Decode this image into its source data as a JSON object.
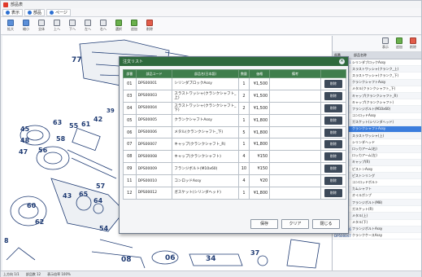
{
  "window": {
    "title": "部品表"
  },
  "menubar": {
    "tabs": [
      {
        "label": "表示"
      },
      {
        "label": "部品"
      },
      {
        "label": "ページ"
      }
    ]
  },
  "toolbar": {
    "buttons": [
      {
        "label": "拡大",
        "icon": "zoom-in-icon"
      },
      {
        "label": "縮小",
        "icon": "zoom-out-icon"
      },
      {
        "label": "全体",
        "icon": "fit-icon"
      },
      {
        "label": "上へ",
        "icon": "up-icon"
      },
      {
        "label": "下へ",
        "icon": "down-icon"
      },
      {
        "label": "左へ",
        "icon": "left-icon"
      },
      {
        "label": "右へ",
        "icon": "right-icon"
      },
      {
        "label": "選択",
        "icon": "select-icon"
      },
      {
        "label": "追加",
        "icon": "add-icon"
      },
      {
        "label": "削除",
        "icon": "delete-icon"
      }
    ]
  },
  "drawing": {
    "part_numbers": [
      "77",
      "39",
      "45",
      "48",
      "47",
      "56",
      "58",
      "55",
      "63",
      "61",
      "42",
      "57",
      "65",
      "43",
      "64",
      "60",
      "62",
      "54",
      "08",
      "06",
      "34",
      "37",
      "8"
    ]
  },
  "right_panel": {
    "toolbar": [
      {
        "label": "表示",
        "icon": "view-icon"
      },
      {
        "label": "追加",
        "icon": "add-icon"
      },
      {
        "label": "削除",
        "icon": "delete-icon"
      }
    ],
    "header": {
      "col1": "部番",
      "col2": "部品名称"
    },
    "rows": [
      {
        "code": "DP500001",
        "name": "シリンダブロックAssy"
      },
      {
        "code": "",
        "name": "スラストワッシャ(クランク_上)"
      },
      {
        "code": "",
        "name": "スラストワッシャ(クランク_下)"
      },
      {
        "code": "",
        "name": "クランクシャフトAssy"
      },
      {
        "code": "",
        "name": "メタル(クランクシャフト_下)"
      },
      {
        "code": "",
        "name": "キャップ(クランクシャフト_R)"
      },
      {
        "code": "",
        "name": "キャップ(クランクシャフト)"
      },
      {
        "code": "",
        "name": "フランジボルト(M10x60)"
      },
      {
        "code": "",
        "name": "コンロッドAssy"
      },
      {
        "code": "",
        "name": "ガスケット(シリンダヘッド)"
      },
      {
        "code": "",
        "name": "クランクシャフトAssy",
        "selected": true
      },
      {
        "code": "",
        "name": "スラストワッシャ(上)"
      },
      {
        "code": "",
        "name": "シリンダヘッド"
      },
      {
        "code": "",
        "name": "ロッカアーム(右)"
      },
      {
        "code": "",
        "name": "ロッカアーム(左)"
      },
      {
        "code": "",
        "name": "キャップ(R)"
      },
      {
        "code": "",
        "name": "ピストンAssy"
      },
      {
        "code": "",
        "name": "ピストンリング"
      },
      {
        "code": "",
        "name": "コンロッドボルト"
      },
      {
        "code": "",
        "name": "カムシャフト"
      },
      {
        "code": "",
        "name": "オイルポンプ"
      },
      {
        "code": "",
        "name": "フランジボルト(M8)"
      },
      {
        "code": "",
        "name": "ガスケット(R)"
      },
      {
        "code": "",
        "name": "メタル(上)"
      },
      {
        "code": "",
        "name": "メタル(下)"
      },
      {
        "code": "DP500046",
        "name": "フランジボルトAssy"
      },
      {
        "code": "DP500047",
        "name": "クランクケースAssy"
      }
    ]
  },
  "status_bar": {
    "items": [
      "上方向 1/1",
      "部品数 12",
      "表示倍率 100%"
    ]
  },
  "dialog": {
    "title": "注文リスト",
    "columns": [
      "部番",
      "部品コード",
      "部品名(日本語)",
      "数量",
      "価格",
      "備考"
    ],
    "rows": [
      {
        "no": "01",
        "code": "DPS00001",
        "name": "シリンダブロックAssy",
        "qty": "1",
        "price": "¥1,500",
        "note": "",
        "action": "削除"
      },
      {
        "no": "03",
        "code": "DPS00003",
        "name": "スラストワッシャ(クランクシャフト_上)",
        "qty": "2",
        "price": "¥1,500",
        "note": "",
        "action": "削除"
      },
      {
        "no": "04",
        "code": "DPS00004",
        "name": "スラストワッシャ(クランクシャフト_下)",
        "qty": "2",
        "price": "¥1,500",
        "note": "",
        "action": "削除"
      },
      {
        "no": "05",
        "code": "DPS00005",
        "name": "クランクシャフトAssy",
        "qty": "1",
        "price": "¥1,800",
        "note": "",
        "action": "削除"
      },
      {
        "no": "06",
        "code": "DPS00006",
        "name": "メタル(クランクシャフト_下)",
        "qty": "5",
        "price": "¥1,800",
        "note": "",
        "action": "削除"
      },
      {
        "no": "07",
        "code": "DPS00007",
        "name": "キャップ(クランクシャフト_R)",
        "qty": "1",
        "price": "¥1,800",
        "note": "",
        "action": "削除"
      },
      {
        "no": "08",
        "code": "DPS00008",
        "name": "キャップ(クランクシャフト)",
        "qty": "4",
        "price": "¥150",
        "note": "",
        "action": "削除"
      },
      {
        "no": "09",
        "code": "DPS00009",
        "name": "フランジボルト(M10x60)",
        "qty": "10",
        "price": "¥150",
        "note": "",
        "action": "削除"
      },
      {
        "no": "11",
        "code": "DPS00010",
        "name": "コンロッドAssy",
        "qty": "4",
        "price": "¥20",
        "note": "",
        "action": "削除"
      },
      {
        "no": "12",
        "code": "DPS00012",
        "name": "ガスケット(シリンダヘッド)",
        "qty": "1",
        "price": "¥1,800",
        "note": "",
        "action": "削除"
      }
    ],
    "buttons": {
      "save": "保存",
      "clear": "クリア",
      "close": "閉じる"
    }
  },
  "colors": {
    "dialog_header": "#2f6a3d",
    "table_header": "#3f7e4c",
    "selection": "#3b7ddd",
    "callout_red": "#e03a2a",
    "drawing_ink": "#1f3b73"
  }
}
